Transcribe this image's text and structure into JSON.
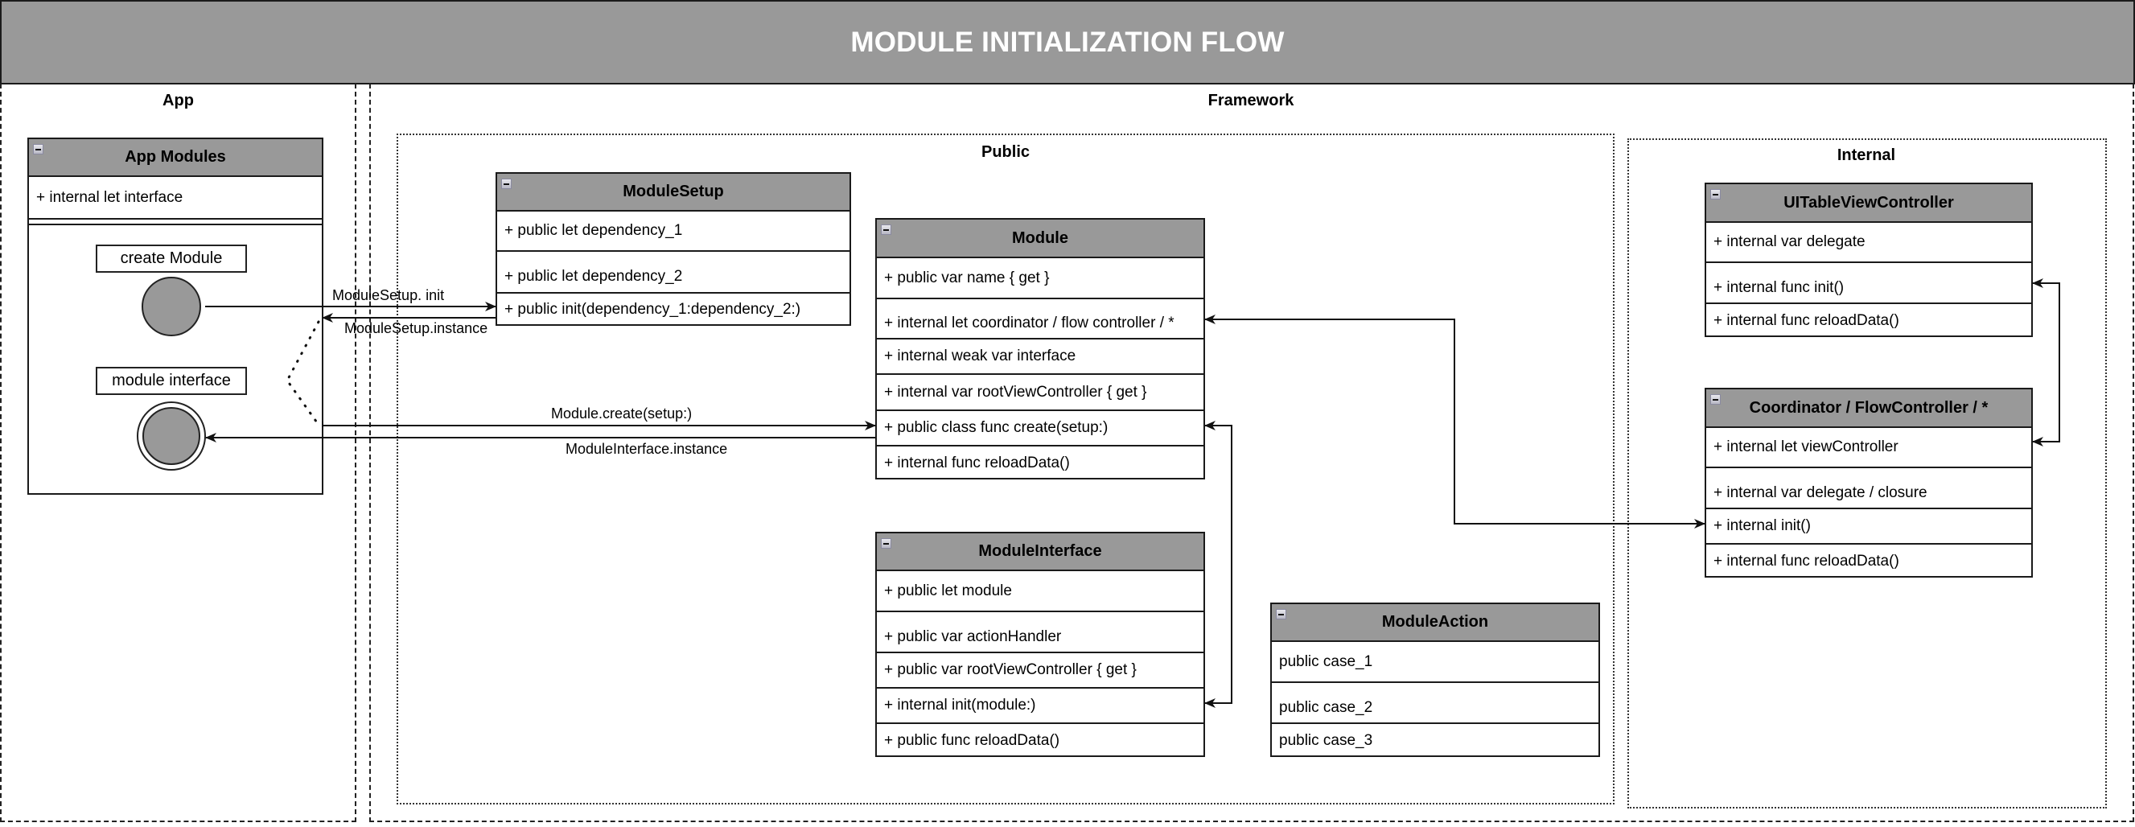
{
  "title": "MODULE INITIALIZATION FLOW",
  "lanes": {
    "app": "App",
    "framework": "Framework"
  },
  "packages": {
    "public": "Public",
    "internal": "Internal"
  },
  "app_modules": {
    "title": "App Modules",
    "rows": [
      "+ internal let interface"
    ],
    "states": {
      "create_module": "create Module",
      "module_interface": "module interface"
    }
  },
  "module_setup": {
    "title": "ModuleSetup",
    "rows": [
      "+ public let dependency_1",
      "+ public let dependency_2",
      "+ public init(dependency_1:dependency_2:)"
    ]
  },
  "module": {
    "title": "Module",
    "rows": [
      "+ public var name { get }",
      "+ internal let coordinator / flow controller / *",
      "+ internal weak var interface",
      "+ internal var rootViewController { get }",
      "+ public class func create(setup:)",
      "+ internal func reloadData()"
    ]
  },
  "module_interface": {
    "title": "ModuleInterface",
    "rows": [
      "+ public let module",
      "+ public var actionHandler",
      "+ public var rootViewController { get }",
      "+ internal init(module:)",
      "+ public func reloadData()"
    ]
  },
  "module_action": {
    "title": "ModuleAction",
    "rows": [
      "public case_1",
      "public case_2",
      "public case_3"
    ]
  },
  "ui_table_view_controller": {
    "title": "UITableViewController",
    "rows": [
      "+ internal var delegate",
      "+ internal func init()",
      "+ internal func reloadData()"
    ]
  },
  "coordinator": {
    "title": "Coordinator / FlowController / *",
    "rows": [
      "+ internal let viewController",
      "+ internal var delegate / closure",
      "+ internal init()",
      "+ internal func reloadData()"
    ]
  },
  "edges": {
    "setup_init": "ModuleSetup. init",
    "setup_instance": "ModuleSetup.instance",
    "module_create": "Module.create(setup:)",
    "interface_instance": "ModuleInterface.instance"
  },
  "colors": {
    "header_fill": "#999999",
    "title_text": "#ffffff",
    "line": "#1a1a1a"
  }
}
